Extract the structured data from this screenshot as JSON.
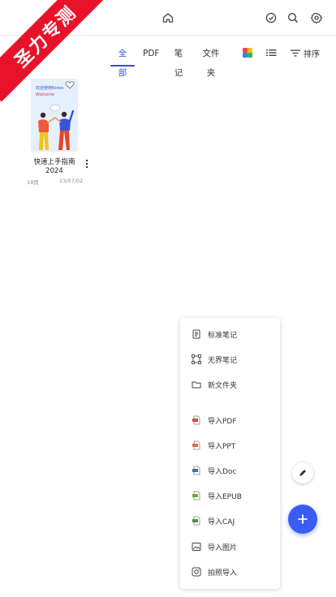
{
  "banner": {
    "text": "圣力专测"
  },
  "topbar": {
    "icons": [
      "sync-icon",
      "home-icon",
      "check-circle-icon",
      "search-icon",
      "settings-icon"
    ]
  },
  "tabs": [
    {
      "label": "全部",
      "active": true
    },
    {
      "label": "PDF",
      "active": false
    },
    {
      "label": "笔记",
      "active": false
    },
    {
      "label": "文件夹",
      "active": false
    }
  ],
  "toolbar": {
    "sort_label": "排序"
  },
  "files": [
    {
      "title_line1": "快速上手指南",
      "title_line2": "2024",
      "pages": "18页",
      "date": "23/07/02",
      "cover_text": "欢迎使用Notes",
      "cover_subtext": "Welcome"
    }
  ],
  "menu": {
    "items": [
      {
        "label": "标准笔记",
        "icon": "document-icon"
      },
      {
        "label": "无界笔记",
        "icon": "infinite-canvas-icon"
      },
      {
        "label": "新文件夹",
        "icon": "folder-icon"
      },
      {
        "label": "导入PDF",
        "icon": "pdf-file-icon",
        "color": "#e0453a"
      },
      {
        "label": "导入PPT",
        "icon": "ppt-file-icon",
        "color": "#e06a3a"
      },
      {
        "label": "导入Doc",
        "icon": "doc-file-icon",
        "color": "#3a6ae0"
      },
      {
        "label": "导入EPUB",
        "icon": "epub-file-icon",
        "color": "#6ab02a"
      },
      {
        "label": "导入CAJ",
        "icon": "caj-file-icon",
        "color": "#3a9a3a"
      },
      {
        "label": "导入图片",
        "icon": "image-icon"
      },
      {
        "label": "拍照导入",
        "icon": "camera-icon"
      }
    ]
  },
  "colors": {
    "accent": "#3b4fd8",
    "fab": "#3a5cf5",
    "banner": "#e8122a"
  }
}
